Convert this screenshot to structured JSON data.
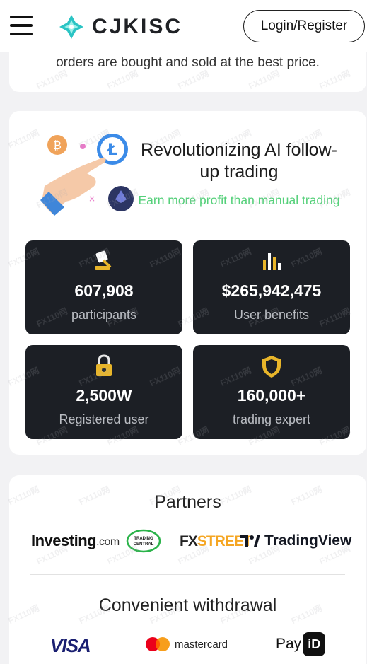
{
  "header": {
    "brand": "CJKISC",
    "login_label": "Login/Register"
  },
  "intro": {
    "text": "orders are bought and sold at the best price."
  },
  "ai": {
    "title": "Revolutionizing AI follow-up trading",
    "subtitle": "Earn more profit than manual trading",
    "stats": [
      {
        "value": "607,908",
        "label": "participants",
        "icon": "gavel-icon"
      },
      {
        "value": "$265,942,475",
        "label": "User benefits",
        "icon": "bar-chart-icon"
      },
      {
        "value": "2,500W",
        "label": "Registered user",
        "icon": "lock-icon"
      },
      {
        "value": "160,000+",
        "label": "trading expert",
        "icon": "shield-icon"
      }
    ]
  },
  "partners": {
    "title": "Partners",
    "logos": {
      "investing": "Investing",
      "investing_suffix": ".com",
      "trading_central": "TRADING CENTRAL",
      "fxstreet_a": "FX",
      "fxstreet_b": "STREET",
      "tradingview": "TradingView"
    }
  },
  "withdrawal": {
    "title": "Convenient withdrawal",
    "methods": {
      "visa": "VISA",
      "mastercard": "mastercard",
      "payid_pay": "Pay",
      "payid_id": "iD"
    }
  },
  "watermark": "FX110网",
  "colors": {
    "accent_green": "#55d07a",
    "stat_bg": "#1c1f25",
    "brand_teal": "#2bc4c4"
  }
}
